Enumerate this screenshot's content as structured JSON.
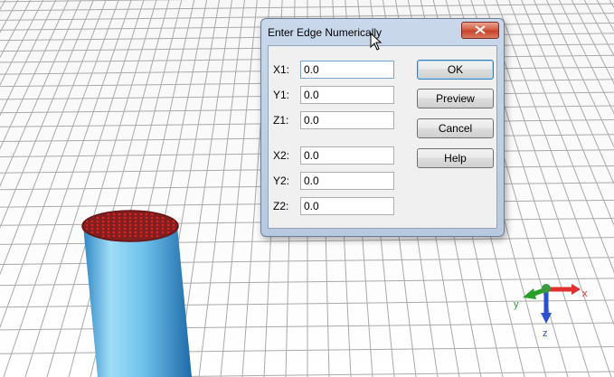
{
  "dialog": {
    "title": "Enter Edge Numerically",
    "fields": [
      {
        "label": "X1:",
        "value": "0.0"
      },
      {
        "label": "Y1:",
        "value": "0.0"
      },
      {
        "label": "Z1:",
        "value": "0.0"
      },
      {
        "label": "X2:",
        "value": "0.0"
      },
      {
        "label": "Y2:",
        "value": "0.0"
      },
      {
        "label": "Z2:",
        "value": "0.0"
      }
    ],
    "buttons": {
      "ok": "OK",
      "preview": "Preview",
      "cancel": "Cancel",
      "help": "Help"
    }
  },
  "triad": {
    "x_label": "x",
    "y_label": "y",
    "z_label": "z"
  },
  "colors": {
    "grid_line": "#a9a9a9",
    "cylinder": "#6fc3ec",
    "face_mesh": "#e02020",
    "dialog_frame": "#c3d4e8",
    "x_axis": "#e03030",
    "y_axis": "#2aa02a",
    "z_axis": "#2a4fd0"
  }
}
